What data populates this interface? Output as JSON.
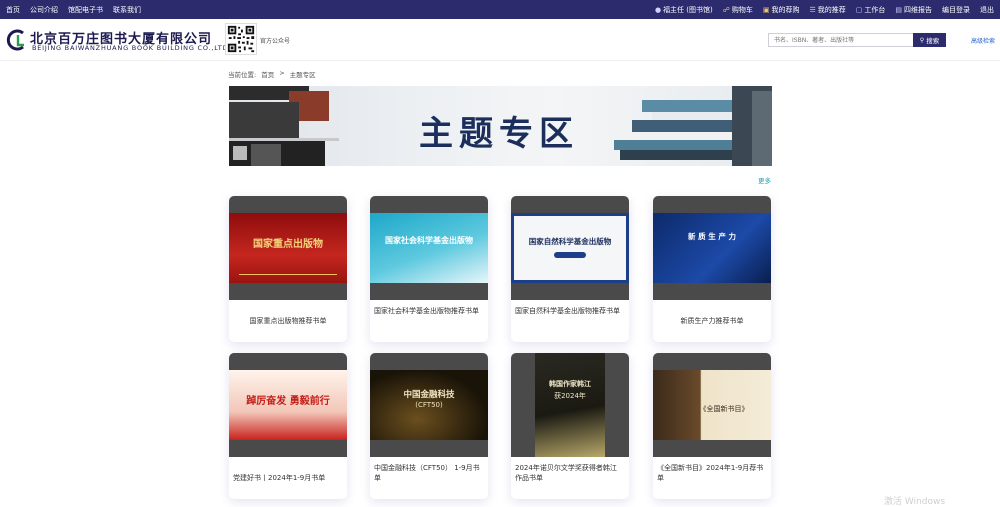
{
  "topbar": {
    "left_links": [
      "首页",
      "公司介绍",
      "馆配电子书",
      "联系我们"
    ],
    "user": "福主任 (图书馆)",
    "cart": "购物车",
    "purchase": "我的荐购",
    "recommend": "我的推荐",
    "workbench": "工作台",
    "report": "四维报告",
    "reports_login": "编目登录",
    "logout": "退出"
  },
  "header": {
    "logo_cn": "北京百万庄图书大厦有限公司",
    "logo_en": "BEIJING BAIWANZHUANG BOOK BUILDING CO.,LTD.",
    "qr_label": "官方公众号",
    "search_placeholder": "书名、ISBN、著者、出版社等",
    "search_button": "搜索",
    "advanced_search": "高级检索"
  },
  "breadcrumb": {
    "prefix": "当前位置:",
    "home": "首页",
    "separator": ">",
    "current": "主题专区"
  },
  "banner": {
    "title": "主题专区"
  },
  "more_label": "更多",
  "cards": [
    {
      "caption": "国家重点出版物推荐书单",
      "art_text": "国家重点出版物"
    },
    {
      "caption": "国家社会科学基金出版物推荐书单",
      "art_text": "国家社会科学基金出版物"
    },
    {
      "caption": "国家自然科学基金出版物推荐书单",
      "art_text": "国家自然科学基金出版物"
    },
    {
      "caption": "新质生产力推荐书单",
      "art_text": "新 质 生 产 力"
    },
    {
      "caption": "党建好书丨2024年1-9月书单",
      "art_text": "踔厉奋发 勇毅前行"
    },
    {
      "caption": "中国金融科技（CFT50） 1-9月书单",
      "art_text": "中国金融科技",
      "art_sub": "(CFT50)"
    },
    {
      "caption": "2024年诺贝尔文学奖获得者韩江 作品书单",
      "art_text": "韩国作家韩江",
      "art_sub": "获2024年"
    },
    {
      "caption": "《全国新书目》2024年1-9月荐书单",
      "art_text": "《全国新书目》"
    }
  ],
  "colors": {
    "topbar": "#2b2b6e",
    "accent_gold": "#f3c95e",
    "link_blue": "#2a66c9",
    "more_teal": "#2a9bb0"
  },
  "watermark": "激活 Windows"
}
